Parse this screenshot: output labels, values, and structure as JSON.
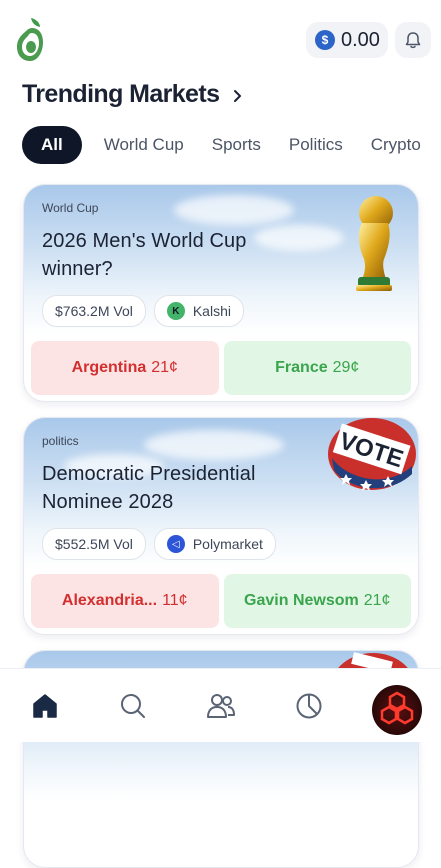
{
  "header": {
    "balance": "0.00",
    "coin_icon": "usdc-coin-icon",
    "bell_icon": "bell-icon",
    "logo_icon": "avocado-logo-icon"
  },
  "section": {
    "title": "Trending Markets"
  },
  "tabs": [
    {
      "label": "All",
      "active": true
    },
    {
      "label": "World Cup",
      "active": false
    },
    {
      "label": "Sports",
      "active": false
    },
    {
      "label": "Politics",
      "active": false
    },
    {
      "label": "Crypto",
      "active": false
    }
  ],
  "markets": [
    {
      "category": "World Cup",
      "title": "2026 Men's World Cup winner?",
      "volume": "$763.2M Vol",
      "source": "Kalshi",
      "source_icon": "kalshi-icon",
      "options": [
        {
          "label": "Argentina",
          "price": "21¢",
          "color": "#d32f2f"
        },
        {
          "label": "France",
          "price": "29¢",
          "color": "#3aa54c"
        }
      ]
    },
    {
      "category": "politics",
      "title": "Democratic Presidential Nominee 2028",
      "volume": "$552.5M Vol",
      "source": "Polymarket",
      "source_icon": "polymarket-icon",
      "options": [
        {
          "label": "Alexandria...",
          "price": "11¢",
          "color": "#d32f2f"
        },
        {
          "label": "Gavin Newsom",
          "price": "21¢",
          "color": "#3aa54c"
        }
      ]
    }
  ],
  "bottom_nav": [
    {
      "icon": "home-icon",
      "active": true
    },
    {
      "icon": "search-icon",
      "active": false
    },
    {
      "icon": "people-icon",
      "active": false
    },
    {
      "icon": "pie-chart-icon",
      "active": false
    },
    {
      "icon": "profile-avatar",
      "active": false
    }
  ]
}
